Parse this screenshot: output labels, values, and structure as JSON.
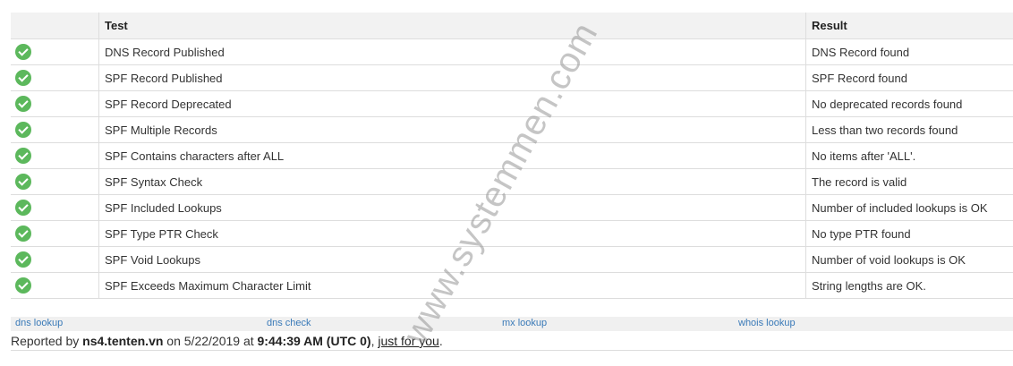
{
  "table": {
    "headers": {
      "status": "",
      "test": "Test",
      "result": "Result"
    },
    "rows": [
      {
        "status_icon": "check-circle-icon",
        "test": "DNS Record Published",
        "result": "DNS Record found"
      },
      {
        "status_icon": "check-circle-icon",
        "test": "SPF Record Published",
        "result": "SPF Record found"
      },
      {
        "status_icon": "check-circle-icon",
        "test": "SPF Record Deprecated",
        "result": "No deprecated records found"
      },
      {
        "status_icon": "check-circle-icon",
        "test": "SPF Multiple Records",
        "result": "Less than two records found"
      },
      {
        "status_icon": "check-circle-icon",
        "test": "SPF Contains characters after ALL",
        "result": "No items after 'ALL'."
      },
      {
        "status_icon": "check-circle-icon",
        "test": "SPF Syntax Check",
        "result": "The record is valid"
      },
      {
        "status_icon": "check-circle-icon",
        "test": "SPF Included Lookups",
        "result": "Number of included lookups is OK"
      },
      {
        "status_icon": "check-circle-icon",
        "test": "SPF Type PTR Check",
        "result": "No type PTR found"
      },
      {
        "status_icon": "check-circle-icon",
        "test": "SPF Void Lookups",
        "result": "Number of void lookups is OK"
      },
      {
        "status_icon": "check-circle-icon",
        "test": "SPF Exceeds Maximum Character Limit",
        "result": "String lengths are OK."
      }
    ]
  },
  "tools": [
    "dns lookup",
    "dns check",
    "mx lookup",
    "whois lookup"
  ],
  "report": {
    "prefix": "Reported by ",
    "server": "ns4.tenten.vn",
    "on_text": " on 5/22/2019 at ",
    "time": "9:44:39 AM (UTC 0)",
    "comma": ", ",
    "link": "just for you",
    "suffix": "."
  },
  "watermark": "www.systemmen.com",
  "colors": {
    "ok": "#5cb85c",
    "link": "#3a7ab8",
    "header_bg": "#f2f2f2"
  }
}
